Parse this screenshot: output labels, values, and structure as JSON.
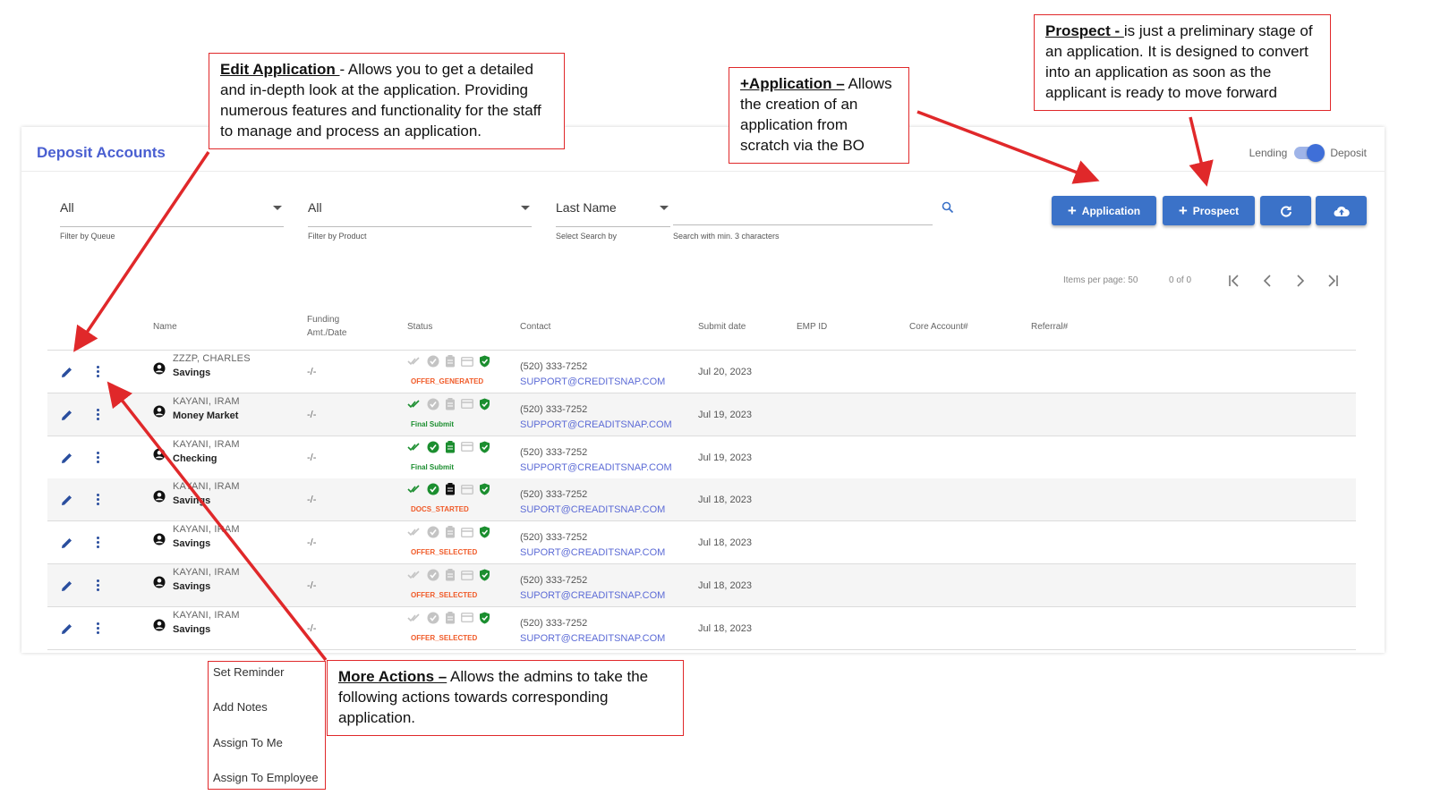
{
  "app": {
    "title": "Deposit Accounts",
    "toggle": {
      "left_label": "Lending",
      "right_label": "Deposit",
      "active": "Deposit"
    },
    "accent_color": "#3b72c8",
    "title_color": "#4a5fd1"
  },
  "filters": {
    "queue": {
      "value": "All",
      "label": "Filter by Queue"
    },
    "product": {
      "value": "All",
      "label": "Filter by Product"
    },
    "search_by": {
      "value": "Last Name",
      "label": "Select Search by"
    },
    "search": {
      "placeholder": "",
      "hint": "Search with min. 3 characters"
    }
  },
  "buttons": {
    "application": "Application",
    "prospect": "Prospect",
    "refresh_icon": "refresh-icon",
    "upload_icon": "cloud-upload-icon"
  },
  "pager": {
    "items_per_page": "Items per page: 50",
    "range": "0 of 0"
  },
  "table": {
    "headers": {
      "name": "Name",
      "funding": "Funding\nAmt./Date",
      "status": "Status",
      "contact": "Contact",
      "submit": "Submit date",
      "emp": "EMP ID",
      "core": "Core Account#",
      "referral": "Referral#"
    },
    "rows": [
      {
        "name": "ZZZP, CHARLES",
        "product": "Savings",
        "funding": "-/-",
        "status": "OFFER_GENERATED",
        "status_color": "#f05a28",
        "phone": "(520) 333-7252",
        "email": "SUPPORT@CREDITSNAP.COM",
        "submit": "Jul 20, 2023"
      },
      {
        "name": "KAYANI, IRAM",
        "product": "Money Market",
        "funding": "-/-",
        "status": "Final Submit",
        "status_color": "#1b8e2f",
        "phone": "(520) 333-7252",
        "email": "SUPPORT@CREADITSNAP.COM",
        "submit": "Jul 19, 2023"
      },
      {
        "name": "KAYANI, IRAM",
        "product": "Checking",
        "funding": "-/-",
        "status": "Final Submit",
        "status_color": "#1b8e2f",
        "phone": "(520) 333-7252",
        "email": "SUPPORT@CREADITSNAP.COM",
        "submit": "Jul 19, 2023"
      },
      {
        "name": "KAYANI, IRAM",
        "product": "Savings",
        "funding": "-/-",
        "status": "DOCS_STARTED",
        "status_color": "#f05a28",
        "phone": "(520) 333-7252",
        "email": "SUPORT@CREADITSNAP.COM",
        "submit": "Jul 18, 2023"
      },
      {
        "name": "KAYANI, IRAM",
        "product": "Savings",
        "funding": "-/-",
        "status": "OFFER_SELECTED",
        "status_color": "#f05a28",
        "phone": "(520) 333-7252",
        "email": "SUPORT@CREADITSNAP.COM",
        "submit": "Jul 18, 2023"
      },
      {
        "name": "KAYANI, IRAM",
        "product": "Savings",
        "funding": "-/-",
        "status": "OFFER_SELECTED",
        "status_color": "#f05a28",
        "phone": "(520) 333-7252",
        "email": "SUPORT@CREADITSNAP.COM",
        "submit": "Jul 18, 2023"
      },
      {
        "name": "KAYANI, IRAM",
        "product": "Savings",
        "funding": "-/-",
        "status": "OFFER_SELECTED",
        "status_color": "#f05a28",
        "phone": "(520) 333-7252",
        "email": "SUPORT@CREADITSNAP.COM",
        "submit": "Jul 18, 2023"
      }
    ]
  },
  "more_menu": [
    "Set Reminder",
    "Add Notes",
    "Assign To Me",
    "Assign To Employee"
  ],
  "annotations": {
    "edit": {
      "title": "Edit Application ",
      "body": "- Allows you to get a detailed and in-depth look at the application. Providing numerous features and functionality for the staff to manage and process an application."
    },
    "application": {
      "title": "+Application –",
      "body": " Allows the creation of an application from scratch via the BO"
    },
    "prospect": {
      "title": "Prospect - ",
      "body": "is just a preliminary stage of an application. It is designed to convert into an application as soon as the applicant is ready to move forward"
    },
    "more": {
      "title": "More Actions –",
      "body": " Allows the admins to take the following actions towards corresponding application."
    }
  },
  "annotation_color": "#e0282a"
}
